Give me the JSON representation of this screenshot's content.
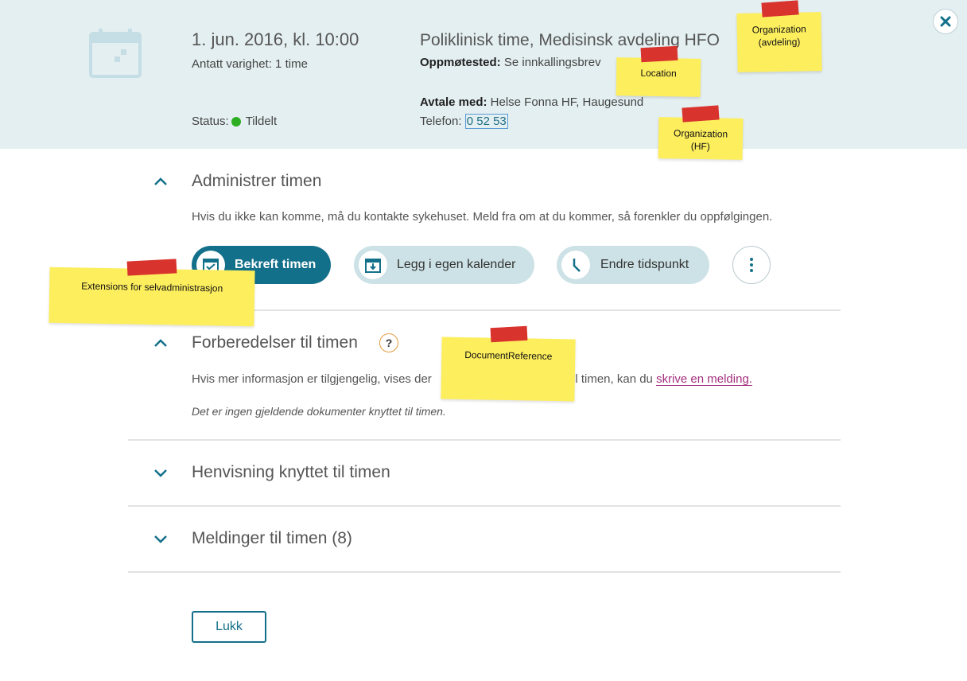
{
  "header": {
    "date": "1. jun. 2016, kl. 10:00",
    "duration": "Antatt varighet: 1 time",
    "status_label": "Status:",
    "status_value": "Tildelt",
    "title": "Poliklinisk time, Medisinsk avdeling HFO",
    "oppmote_label": "Oppmøtested:",
    "oppmote_value": "Se innkallingsbrev",
    "avtale_label": "Avtale med:",
    "avtale_value": "Helse Fonna HF, Haugesund",
    "telefon_label": "Telefon:",
    "telefon_value": "0 52 53",
    "status_color": "#2dae22"
  },
  "administrer": {
    "title": "Administrer timen",
    "description": "Hvis du ikke kan komme, må du kontakte sykehuset. Meld fra om at du kommer, så forenkler du oppfølgingen.",
    "buttons": {
      "confirm": "Bekreft timen",
      "calendar": "Legg i egen kalender",
      "change": "Endre tidspunkt"
    }
  },
  "forberedelser": {
    "title": "Forberedelser til timen",
    "help": "?",
    "desc_prefix": "Hvis mer informasjon er tilgjengelig, vises der",
    "desc_middle": "il timen, kan du",
    "link": "skrive en melding.",
    "empty": "Det er ingen gjeldende dokumenter knyttet til timen."
  },
  "henvisning": {
    "title": "Henvisning knyttet til timen"
  },
  "meldinger": {
    "title": "Meldinger til timen (8)"
  },
  "footer": {
    "close_label": "Lukk"
  },
  "notes": {
    "org_avdeling": "Organization (avdeling)",
    "location": "Location",
    "org_hf": "Organization (HF)",
    "extensions": "Extensions for selvadministrasjon",
    "document_ref": "DocumentReference"
  },
  "colors": {
    "accent": "#13708a",
    "header_bg": "#e4eff1",
    "note": "#fdee5e",
    "tape": "#d9332d",
    "link": "#a3307e"
  }
}
